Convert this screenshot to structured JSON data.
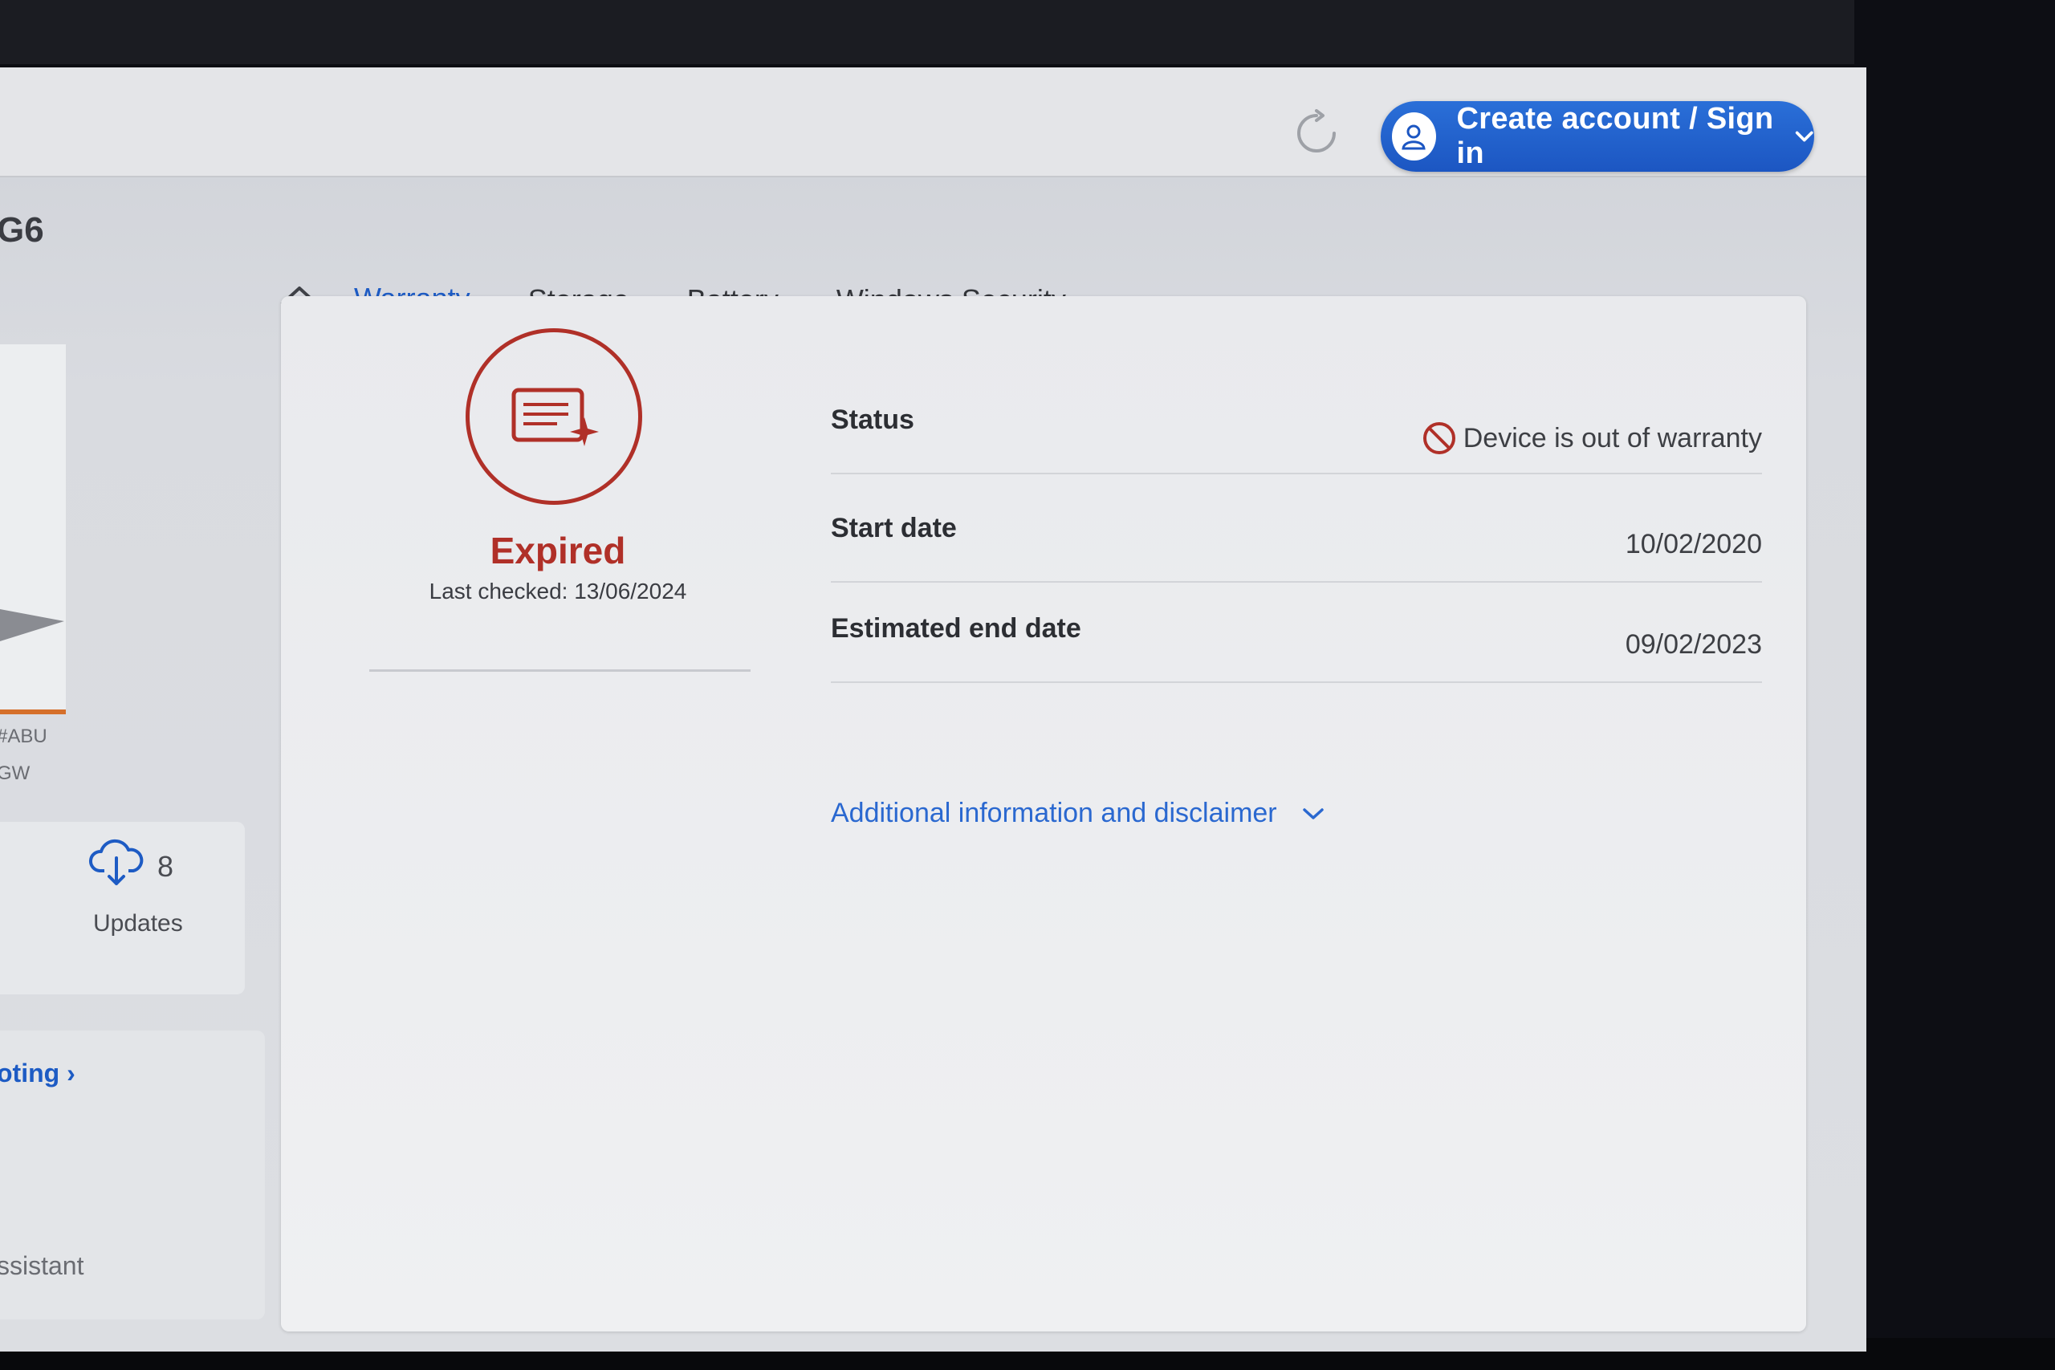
{
  "header": {
    "model_fragment": "G6",
    "signin_label": "Create account / Sign in"
  },
  "tabs": [
    {
      "label": "Warranty",
      "active": true
    },
    {
      "label": "Storage",
      "active": false
    },
    {
      "label": "Battery",
      "active": false
    },
    {
      "label": "Windows Security",
      "active": false
    }
  ],
  "left_panel": {
    "sku_line1": "#ABU",
    "sku_line2": "GW",
    "updates_count": "8",
    "updates_label": "Updates",
    "troubleshoot_link": "oting ›",
    "assistant_label": "ssistant"
  },
  "warranty": {
    "status_title": "Expired",
    "last_checked": "Last checked: 13/06/2024",
    "rows": [
      {
        "label": "Status",
        "value": "Device is out of warranty"
      },
      {
        "label": "Start date",
        "value": "10/02/2020"
      },
      {
        "label": "Estimated end date",
        "value": "09/02/2023"
      }
    ],
    "disclaimer": "Additional information and disclaimer"
  },
  "colors": {
    "accent_blue": "#1d5bc4",
    "expired_red": "#b03028"
  }
}
